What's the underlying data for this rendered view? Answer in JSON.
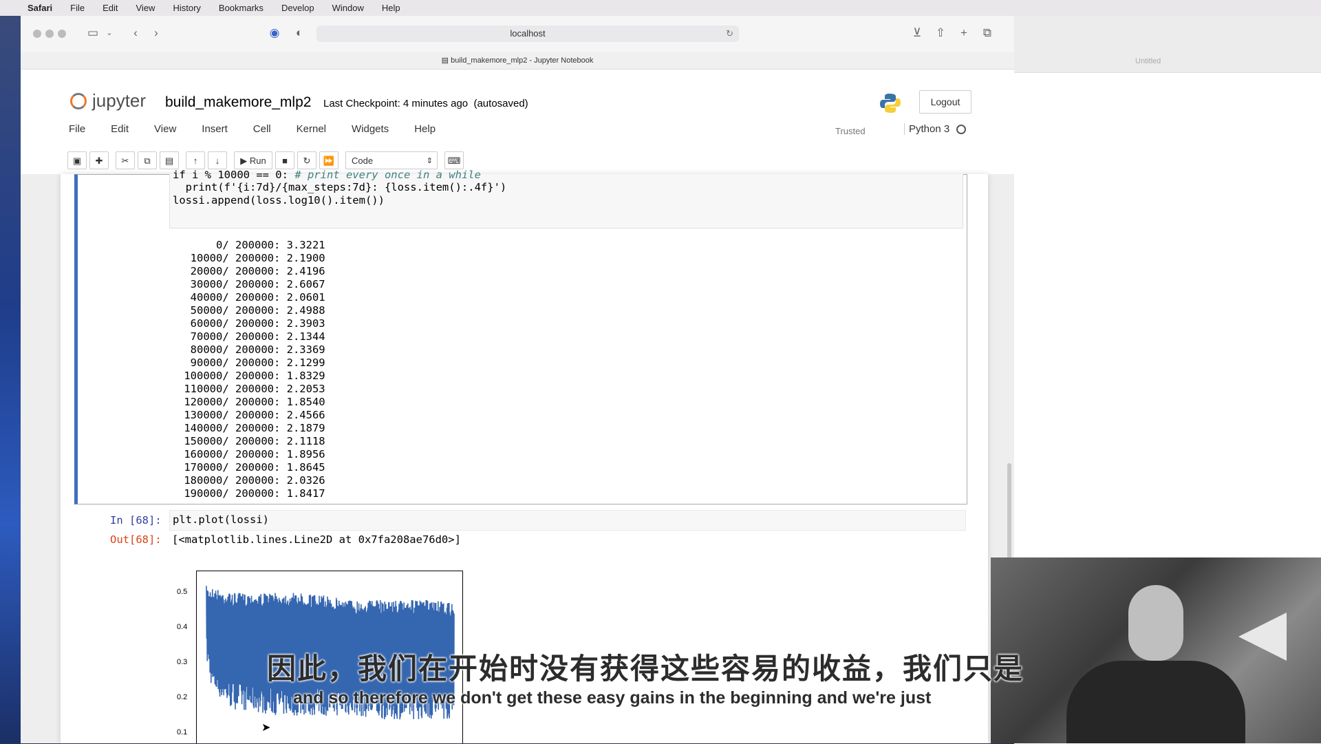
{
  "menubar": {
    "app": "Safari",
    "items": [
      "File",
      "Edit",
      "View",
      "History",
      "Bookmarks",
      "Develop",
      "Window",
      "Help"
    ]
  },
  "browser": {
    "address": "localhost",
    "tab_title": "build_makemore_mlp2 - Jupyter Notebook"
  },
  "second_window": {
    "tab_title": "Untitled"
  },
  "jupyter": {
    "logo_text": "jupyter",
    "notebook_name": "build_makemore_mlp2",
    "checkpoint": "Last Checkpoint: 4 minutes ago",
    "autosave": "(autosaved)",
    "logout": "Logout",
    "menu": [
      "File",
      "Edit",
      "View",
      "Insert",
      "Cell",
      "Kernel",
      "Widgets",
      "Help"
    ],
    "trusted": "Trusted",
    "kernel": "Python 3",
    "toolbar": {
      "run": "Run",
      "cell_type": "Code"
    }
  },
  "cell1": {
    "code_lines": [
      {
        "text": "if i % 10000 == 0: ",
        "comment": "# print every once in a while"
      },
      {
        "text": "  print(f'{i:7d}/{max_steps:7d}: {loss.item():.4f}')",
        "comment": ""
      },
      {
        "text": "lossi.append(loss.log10().item())",
        "comment": ""
      }
    ],
    "output_lines": [
      "      0/ 200000: 3.3221",
      "  10000/ 200000: 2.1900",
      "  20000/ 200000: 2.4196",
      "  30000/ 200000: 2.6067",
      "  40000/ 200000: 2.0601",
      "  50000/ 200000: 2.4988",
      "  60000/ 200000: 2.3903",
      "  70000/ 200000: 2.1344",
      "  80000/ 200000: 2.3369",
      "  90000/ 200000: 2.1299",
      " 100000/ 200000: 1.8329",
      " 110000/ 200000: 2.2053",
      " 120000/ 200000: 1.8540",
      " 130000/ 200000: 2.4566",
      " 140000/ 200000: 2.1879",
      " 150000/ 200000: 2.1118",
      " 160000/ 200000: 1.8956",
      " 170000/ 200000: 1.8645",
      " 180000/ 200000: 2.0326",
      " 190000/ 200000: 1.8417"
    ]
  },
  "cell2": {
    "in_prompt": "In [68]:",
    "code": "plt.plot(lossi)",
    "out_prompt": "Out[68]:",
    "out_text": "[<matplotlib.lines.Line2D at 0x7fa208ae76d0>]"
  },
  "chart_data": {
    "type": "line",
    "series": [
      {
        "color": "#3566b0"
      }
    ],
    "x_range": [
      0,
      200000
    ],
    "y_range": [
      0.08,
      0.55
    ],
    "xticks": [
      "0",
      "25000",
      "50000",
      "75000",
      "100000",
      "125000",
      "150000",
      "175000",
      "200000"
    ],
    "yticks": [
      "0.1",
      "0.2",
      "0.3",
      "0.4",
      "0.5"
    ],
    "envelope_upper": [
      [
        0,
        0.52
      ],
      [
        10000,
        0.51
      ],
      [
        20000,
        0.5
      ],
      [
        40000,
        0.5
      ],
      [
        60000,
        0.5
      ],
      [
        80000,
        0.5
      ],
      [
        100000,
        0.49
      ],
      [
        120000,
        0.48
      ],
      [
        140000,
        0.48
      ],
      [
        160000,
        0.48
      ],
      [
        180000,
        0.48
      ],
      [
        200000,
        0.47
      ]
    ],
    "envelope_lower": [
      [
        0,
        0.3
      ],
      [
        5000,
        0.22
      ],
      [
        20000,
        0.17
      ],
      [
        40000,
        0.16
      ],
      [
        60000,
        0.15
      ],
      [
        80000,
        0.15
      ],
      [
        100000,
        0.15
      ],
      [
        120000,
        0.15
      ],
      [
        140000,
        0.14
      ],
      [
        160000,
        0.14
      ],
      [
        180000,
        0.14
      ],
      [
        200000,
        0.14
      ]
    ]
  },
  "subtitles": {
    "chinese": "因此，我们在开始时没有获得这些容易的收益，我们只是",
    "english": "and so therefore we don't get these easy gains in the beginning and we're just"
  }
}
